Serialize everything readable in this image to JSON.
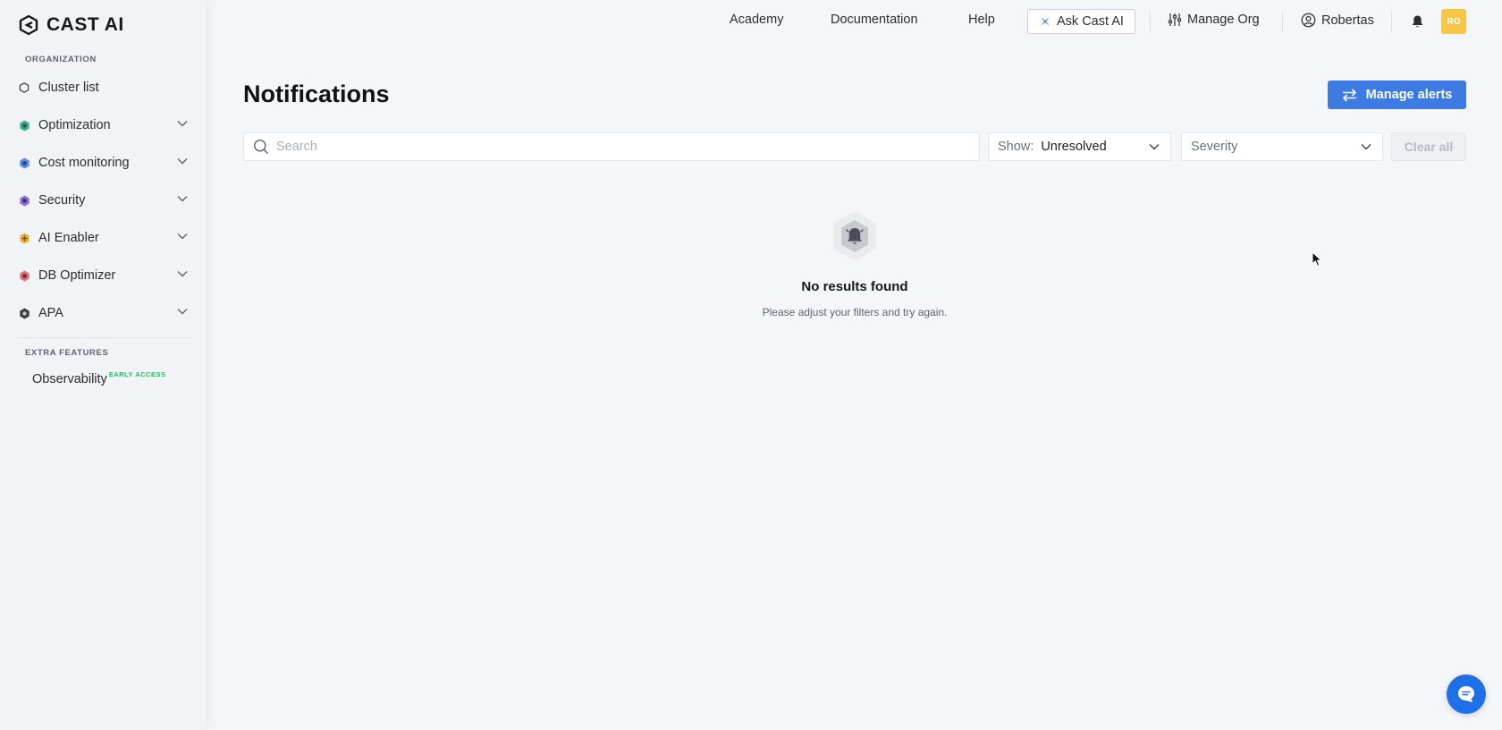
{
  "brand": {
    "name": "CAST AI"
  },
  "sidebar": {
    "organization_label": "ORGANIZATION",
    "items": [
      {
        "label": "Cluster list",
        "icon": "hexagon-outline-icon",
        "expandable": false
      },
      {
        "label": "Optimization",
        "icon": "optimization-icon",
        "expandable": true
      },
      {
        "label": "Cost monitoring",
        "icon": "cost-monitoring-icon",
        "expandable": true
      },
      {
        "label": "Security",
        "icon": "shield-icon",
        "expandable": true
      },
      {
        "label": "AI Enabler",
        "icon": "ai-enabler-icon",
        "expandable": true
      },
      {
        "label": "DB Optimizer",
        "icon": "database-icon",
        "expandable": true
      },
      {
        "label": "APA",
        "icon": "apa-icon",
        "expandable": true
      }
    ],
    "extra_label": "EXTRA FEATURES",
    "extra_items": [
      {
        "label": "Observability",
        "badge": "EARLY ACCESS"
      }
    ]
  },
  "topbar": {
    "links": [
      "Academy",
      "Documentation",
      "Help"
    ],
    "ask_label": "Ask Cast AI",
    "manage_org_label": "Manage Org",
    "user_label": "Robertas",
    "avatar_initials": "RO"
  },
  "main": {
    "title": "Notifications",
    "manage_alerts_label": "Manage alerts",
    "search_placeholder": "Search",
    "show_filter": {
      "label": "Show:",
      "value": "Unresolved"
    },
    "severity_placeholder": "Severity",
    "clear_all_label": "Clear all",
    "empty_state": {
      "title": "No results found",
      "subtitle": "Please adjust your filters and try again."
    }
  },
  "colors": {
    "accent": "#3d7be3",
    "avatar": "#f6c646",
    "badge_green": "#2fb267",
    "chat": "#1f6fe6"
  }
}
